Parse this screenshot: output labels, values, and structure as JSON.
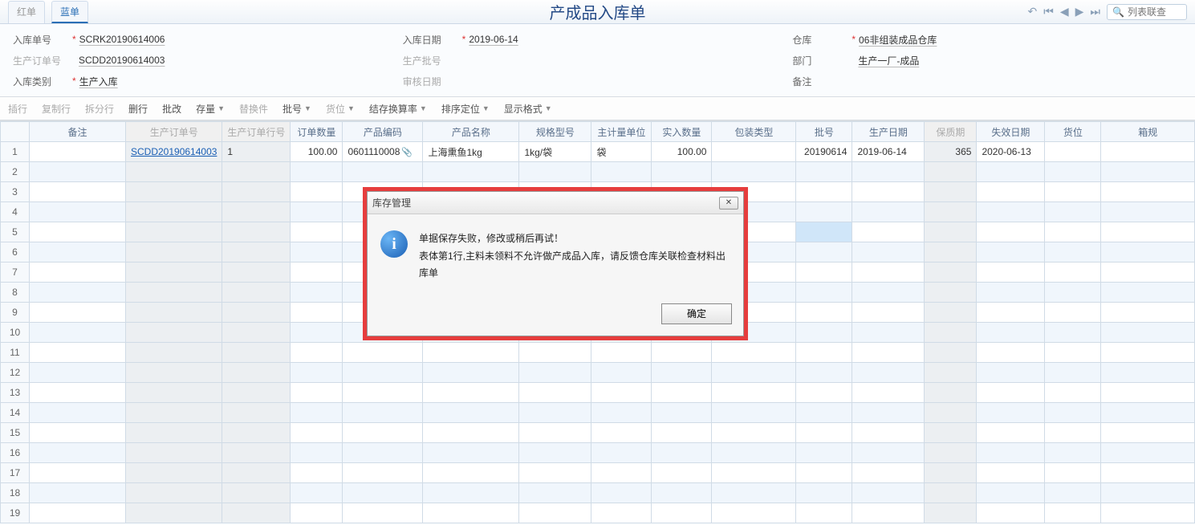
{
  "header": {
    "tabs": [
      "红单",
      "蓝单"
    ],
    "title": "产成品入库单",
    "search_placeholder": "列表联查"
  },
  "form": {
    "col1": {
      "r1": {
        "label": "入库单号",
        "value": "SCRK20190614006"
      },
      "r2": {
        "label": "生产订单号",
        "value": "SCDD20190614003"
      },
      "r3": {
        "label": "入库类别",
        "value": "生产入库"
      }
    },
    "col2": {
      "r1": {
        "label": "入库日期",
        "value": "2019-06-14"
      },
      "r2": {
        "label": "生产批号",
        "value": ""
      },
      "r3": {
        "label": "审核日期",
        "value": ""
      }
    },
    "col3": {
      "r1": {
        "label": "仓库",
        "value": "06非组装成品仓库"
      },
      "r2": {
        "label": "部门",
        "value": "生产一厂-成品"
      },
      "r3": {
        "label": "备注",
        "value": ""
      }
    }
  },
  "toolbar": {
    "insert": "插行",
    "copy": "复制行",
    "split": "拆分行",
    "del": "删行",
    "batch": "批改",
    "stock": "存量",
    "replace": "替换件",
    "lotno": "批号",
    "loc": "货位",
    "conv": "结存换算率",
    "sort": "排序定位",
    "format": "显示格式"
  },
  "columns": {
    "remark": "备注",
    "prod_order": "生产订单号",
    "prod_line": "生产订单行号",
    "order_qty": "订单数量",
    "prod_code": "产品编码",
    "prod_name": "产品名称",
    "spec": "规格型号",
    "unit": "主计量单位",
    "real_qty": "实入数量",
    "pack": "包装类型",
    "lot": "批号",
    "prod_date": "生产日期",
    "shelf": "保质期",
    "expire": "失效日期",
    "bin": "货位",
    "box": "箱规"
  },
  "row1": {
    "remark": "",
    "prod_order": "SCDD20190614003",
    "prod_line": "1",
    "order_qty": "100.00",
    "prod_code": "0601110008",
    "prod_name": "上海熏鱼1kg",
    "spec": "1kg/袋",
    "unit": "袋",
    "real_qty": "100.00",
    "pack": "",
    "lot": "20190614",
    "prod_date": "2019-06-14",
    "shelf": "365",
    "expire": "2020-06-13",
    "bin": ""
  },
  "dialog": {
    "title": "库存管理",
    "line1": "单据保存失败，修改或稍后再试！",
    "line2": "表体第1行,主料未领料不允许做产成品入库，请反馈仓库关联检查材料出库单",
    "ok": "确定"
  }
}
